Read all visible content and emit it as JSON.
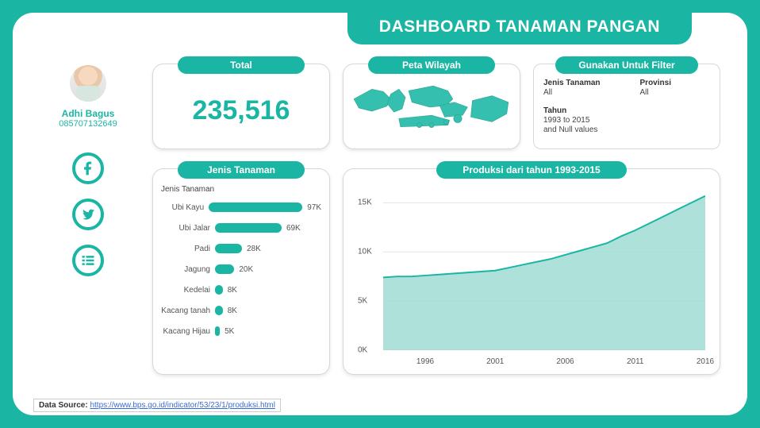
{
  "title": "DASHBOARD TANAMAN PANGAN",
  "creator": {
    "name": "Adhi Bagus",
    "phone": "085707132649"
  },
  "social": {
    "facebook": "facebook-icon",
    "twitter": "twitter-icon",
    "list": "list-icon"
  },
  "total": {
    "label": "Total",
    "value": "235,516"
  },
  "map": {
    "label": "Peta Wilayah"
  },
  "filter": {
    "label": "Gunakan Untuk Filter",
    "jenis_label": "Jenis Tanaman",
    "jenis_value": "All",
    "prov_label": "Provinsi",
    "prov_value": "All",
    "tahun_label": "Tahun",
    "tahun_value": "1993 to 2015",
    "tahun_value2": "and Null values"
  },
  "jenis": {
    "label": "Jenis Tanaman",
    "subtitle": "Jenis Tanaman",
    "items": [
      {
        "name": "Ubi Kayu",
        "value": 97,
        "text": "97K"
      },
      {
        "name": "Ubi Jalar",
        "value": 69,
        "text": "69K"
      },
      {
        "name": "Padi",
        "value": 28,
        "text": "28K"
      },
      {
        "name": "Jagung",
        "value": 20,
        "text": "20K"
      },
      {
        "name": "Kedelai",
        "value": 8,
        "text": "8K"
      },
      {
        "name": "Kacang tanah",
        "value": 8,
        "text": "8K"
      },
      {
        "name": "Kacang Hijau",
        "value": 5,
        "text": "5K"
      }
    ]
  },
  "line": {
    "label": "Produksi dari tahun 1993-2015",
    "yticks": [
      "0K",
      "5K",
      "10K",
      "15K"
    ],
    "xticks": [
      "1996",
      "2001",
      "2006",
      "2011",
      "2016"
    ]
  },
  "datasource": {
    "prefix": "Data Source: ",
    "link_text": "https://www.bps.go.id/indicator/53/23/1/produksi.html"
  },
  "chart_data": [
    {
      "type": "bar",
      "title": "Jenis Tanaman",
      "orientation": "horizontal",
      "categories": [
        "Ubi Kayu",
        "Ubi Jalar",
        "Padi",
        "Jagung",
        "Kedelai",
        "Kacang tanah",
        "Kacang Hijau"
      ],
      "values": [
        97000,
        69000,
        28000,
        20000,
        8000,
        8000,
        5000
      ],
      "xlabel": "",
      "ylabel": ""
    },
    {
      "type": "area",
      "title": "Produksi dari tahun 1993-2015",
      "x": [
        1993,
        1994,
        1995,
        1996,
        1997,
        1998,
        1999,
        2000,
        2001,
        2002,
        2003,
        2004,
        2005,
        2006,
        2007,
        2008,
        2009,
        2010,
        2011,
        2012,
        2013,
        2014,
        2015,
        2016
      ],
      "series": [
        {
          "name": "Produksi",
          "values": [
            7400,
            7500,
            7500,
            7600,
            7700,
            7800,
            7900,
            8000,
            8100,
            8400,
            8700,
            9000,
            9300,
            9700,
            10100,
            10500,
            10900,
            11600,
            12200,
            12900,
            13600,
            14300,
            15000,
            15700
          ]
        }
      ],
      "xlabel": "",
      "ylabel": "",
      "ylim": [
        0,
        16000
      ],
      "xlim": [
        1993,
        2016
      ]
    }
  ]
}
